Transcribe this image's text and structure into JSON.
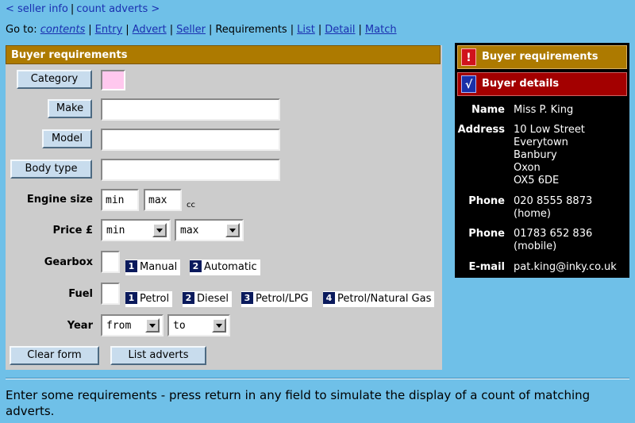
{
  "topnav": {
    "prev": "< seller info",
    "next": "count adverts >"
  },
  "goto": {
    "label": "Go to:",
    "items": [
      {
        "label": "contents",
        "style": "italic-link"
      },
      {
        "label": "Entry",
        "style": "link"
      },
      {
        "label": "Advert",
        "style": "link"
      },
      {
        "label": "Seller",
        "style": "link"
      },
      {
        "label": "Requirements",
        "style": "current"
      },
      {
        "label": "List",
        "style": "link"
      },
      {
        "label": "Detail",
        "style": "link"
      },
      {
        "label": "Match",
        "style": "link"
      }
    ]
  },
  "form": {
    "title": "Buyer requirements",
    "category_button": "Category",
    "category_color": "#ffc8ee",
    "make_button": "Make",
    "model_button": "Model",
    "body_type_button": "Body type",
    "engine_label": "Engine size",
    "engine_min": "min",
    "engine_max": "max",
    "engine_unit": "cc",
    "price_label": "Price £",
    "price_min": "min",
    "price_max": "max",
    "gearbox_label": "Gearbox",
    "gearbox_options": [
      {
        "num": "1",
        "label": "Manual"
      },
      {
        "num": "2",
        "label": "Automatic"
      }
    ],
    "fuel_label": "Fuel",
    "fuel_options": [
      {
        "num": "1",
        "label": "Petrol"
      },
      {
        "num": "2",
        "label": "Diesel"
      },
      {
        "num": "3",
        "label": "Petrol/LPG"
      },
      {
        "num": "4",
        "label": "Petrol/Natural Gas"
      }
    ],
    "year_label": "Year",
    "year_from": "from",
    "year_to": "to",
    "clear_button": "Clear form",
    "list_button": "List adverts"
  },
  "sidepanel": {
    "req_icon": "!",
    "req_title": "Buyer requirements",
    "details_icon": "√",
    "details_title": "Buyer details",
    "name_key": "Name",
    "name_val": "Miss P. King",
    "address_key": "Address",
    "address_val": "10 Low Street\nEverytown\nBanbury\nOxon\nOX5 6DE",
    "phone1_key": "Phone",
    "phone1_val": "020 8555 8873\n(home)",
    "phone2_key": "Phone",
    "phone2_val": "01783 652 836\n(mobile)",
    "email_key": "E-mail",
    "email_val": "pat.king@inky.co.uk"
  },
  "message": "Enter some requirements - press return in any field to simulate the display of a count of matching adverts.",
  "colors": {
    "background": "#6fc0e8",
    "form_header": "#ad7a00",
    "details_header": "#a30000"
  }
}
